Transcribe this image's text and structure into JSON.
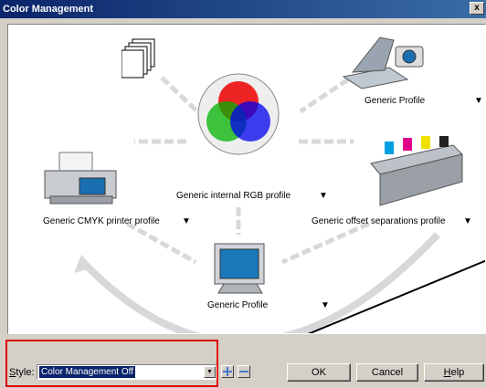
{
  "window": {
    "title": "Color Management",
    "close_label": "x"
  },
  "diagram": {
    "scanner_label": "Generic Profile",
    "monitor_label": "Generic Profile",
    "rgb_label": "Generic internal RGB profile",
    "cmyk_label": "Generic CMYK printer profile",
    "offset_label": "Generic offset separations profile",
    "dropdown_glyph": "▼"
  },
  "bottom": {
    "style_prefix": "S",
    "style_rest": "tyle:",
    "style_value": "Color Management Off",
    "ok": "OK",
    "cancel": "Cancel",
    "help_prefix": "H",
    "help_rest": "elp"
  },
  "colors": {
    "highlight": "#e00000",
    "titlebar": "#0a246a"
  }
}
